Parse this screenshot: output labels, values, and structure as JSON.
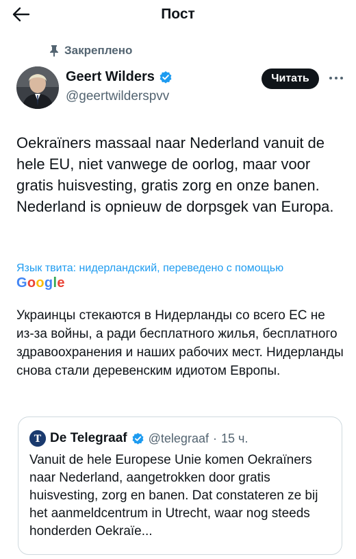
{
  "header": {
    "title": "Пост",
    "back_icon": "arrow-left-icon"
  },
  "pinned": {
    "label": "Закреплено",
    "icon": "pin-icon"
  },
  "author": {
    "name": "Geert Wilders",
    "handle": "@geertwilderspvv",
    "verified": true,
    "verified_color": "#1d9bf0"
  },
  "actions": {
    "follow_label": "Читать",
    "more_icon": "more-horizontal-icon"
  },
  "tweet": {
    "text": "Oekraïners massaal naar Nederland vanuit de hele EU, niet vanwege de oorlog, maar voor gratis huisvesting, gratis zorg en onze banen. Nederland is opnieuw de dorpsgek van Europa."
  },
  "translation": {
    "note": "Язык твита: нидерландский, переведено с помощью",
    "provider": "Google",
    "text": "Украинцы стекаются в Нидерланды со всего ЕС не из-за войны, а ради бесплатного жилья, бесплатного здравоохранения и наших рабочих мест. Нидерланды снова стали деревенским идиотом Европы."
  },
  "quote": {
    "name": "De Telegraaf",
    "handle": "@telegraaf",
    "separator": "·",
    "time": "15 ч.",
    "verified": true,
    "text": "Vanuit de hele Europese Unie komen Oekraïners naar Nederland, aangetrokken door gratis huisvesting, zorg en banen. Dat constateren ze bij het aanmeldcentrum in Utrecht, waar nog steeds honderden Oekraïe..."
  },
  "colors": {
    "accent": "#1d9bf0",
    "text": "#0f1419",
    "secondary": "#536471",
    "border": "#cfd9de"
  }
}
